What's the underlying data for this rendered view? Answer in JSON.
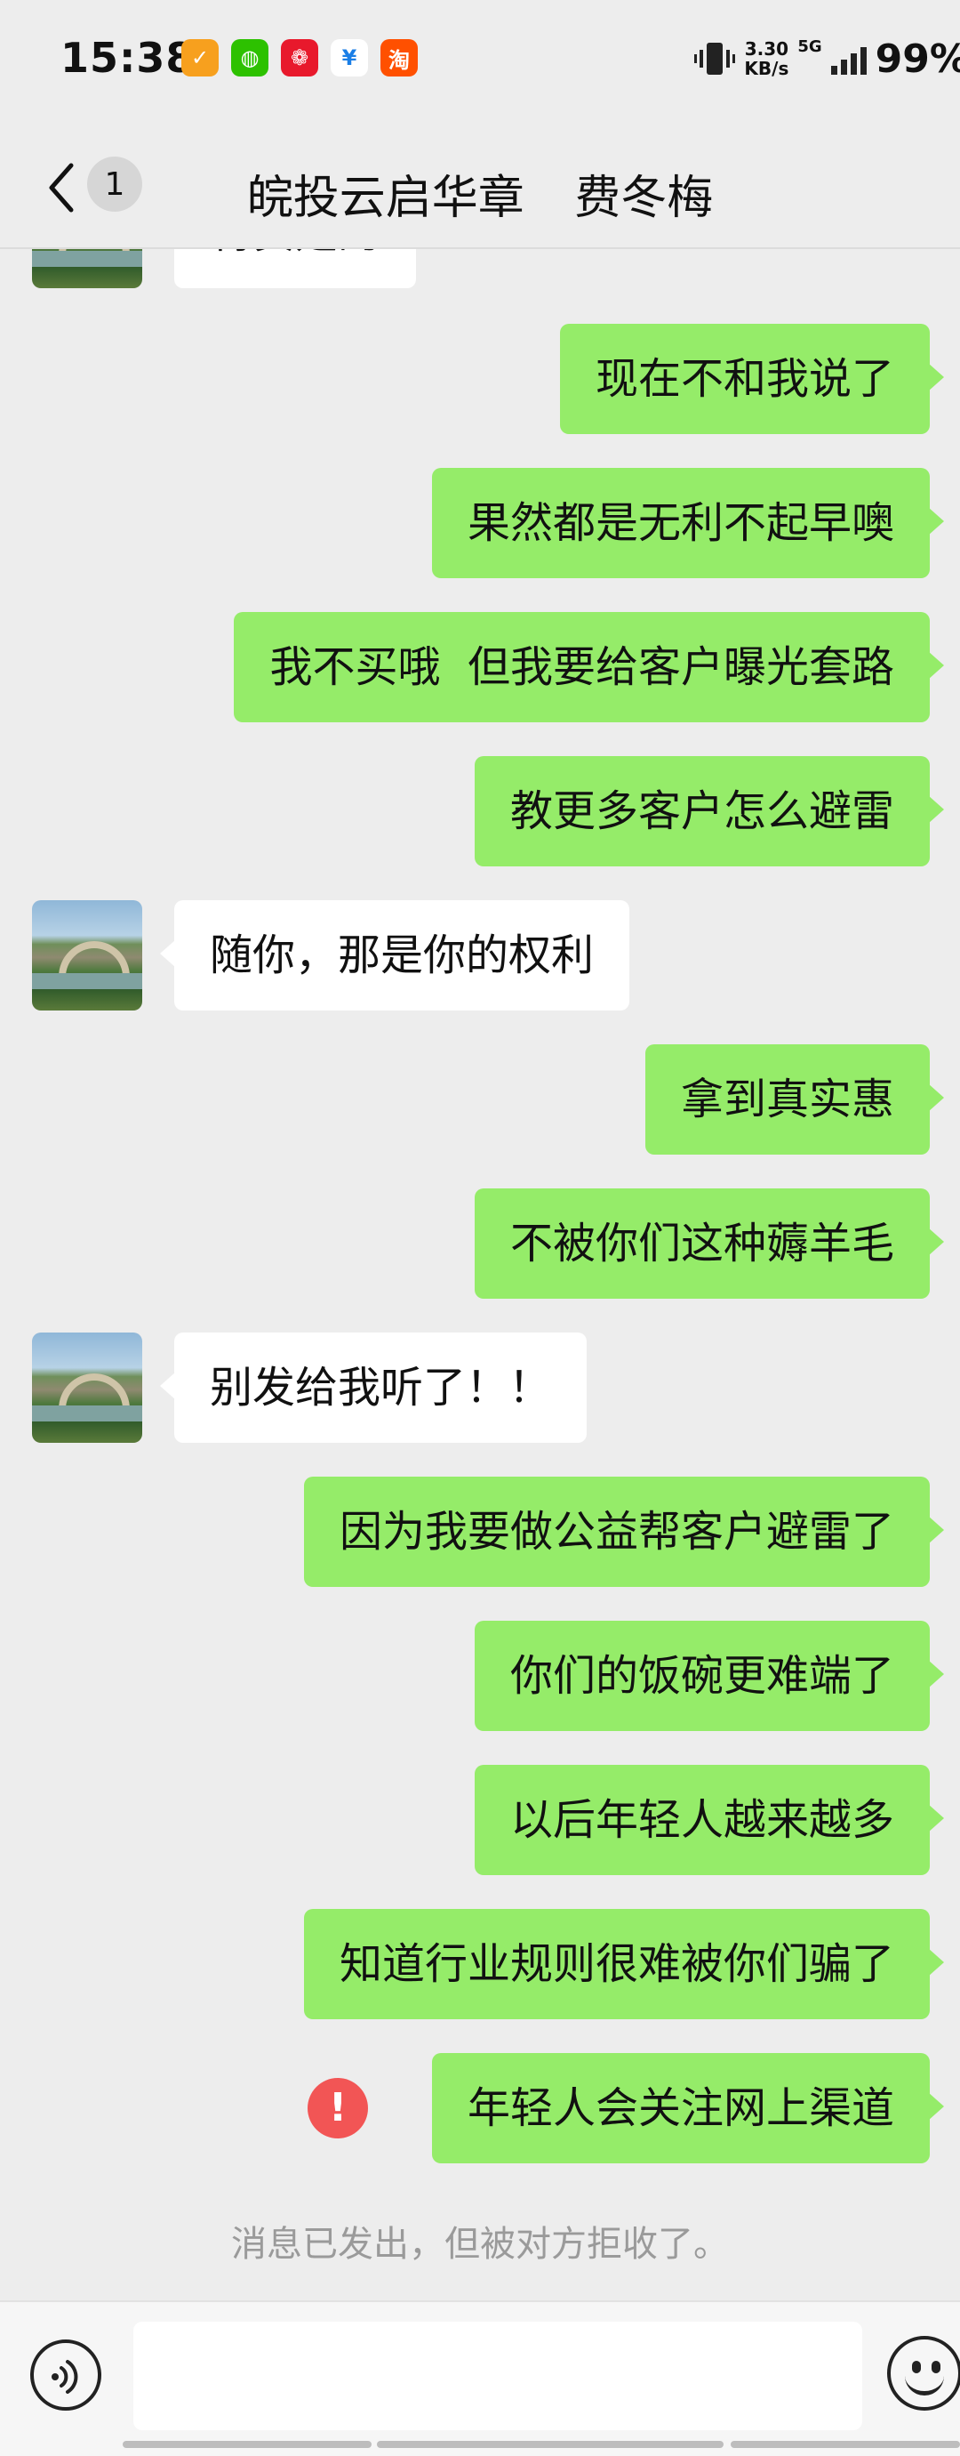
{
  "status_bar": {
    "time": "15:38",
    "net_speed_value": "3.30",
    "net_speed_unit": "KB/s",
    "signal_label": "5G",
    "battery": "99%",
    "app_icons": [
      {
        "name": "app-icon-orange",
        "color": "#f7a01e",
        "glyph": "✓"
      },
      {
        "name": "wechat-icon",
        "color": "#2dc100",
        "glyph": "◍"
      },
      {
        "name": "app-icon-red",
        "color": "#e8192c",
        "glyph": "❁"
      },
      {
        "name": "app-icon-blue",
        "color": "#ffffff",
        "glyph": "¥"
      },
      {
        "name": "taobao-icon",
        "color": "#ff5000",
        "glyph": "淘"
      }
    ]
  },
  "header": {
    "unread_count": "1",
    "contact_name": "皖投云启华章",
    "contact_person": "费冬梅"
  },
  "messages": [
    {
      "from": "them",
      "text": "特贵是的"
    },
    {
      "from": "me",
      "text": "现在不和我说了"
    },
    {
      "from": "me",
      "text": "果然都是无利不起早噢"
    },
    {
      "from": "me",
      "text": "我不买哦  但我要给客户曝光套路"
    },
    {
      "from": "me",
      "text": "教更多客户怎么避雷"
    },
    {
      "from": "them",
      "text": "随你，那是你的权利"
    },
    {
      "from": "me",
      "text": "拿到真实惠"
    },
    {
      "from": "me",
      "text": "不被你们这种薅羊毛"
    },
    {
      "from": "them",
      "text": "别发给我听了！！"
    },
    {
      "from": "me",
      "text": "因为我要做公益帮客户避雷了"
    },
    {
      "from": "me",
      "text": "你们的饭碗更难端了"
    },
    {
      "from": "me",
      "text": "以后年轻人越来越多"
    },
    {
      "from": "me",
      "text": "知道行业规则很难被你们骗了"
    },
    {
      "from": "me",
      "text": "年轻人会关注网上渠道",
      "failed": true
    }
  ],
  "system_note": "消息已发出，但被对方拒收了。",
  "colors": {
    "my_bubble": "#95ec69",
    "their_bubble": "#ffffff",
    "background": "#ededed",
    "error": "#f25555"
  }
}
